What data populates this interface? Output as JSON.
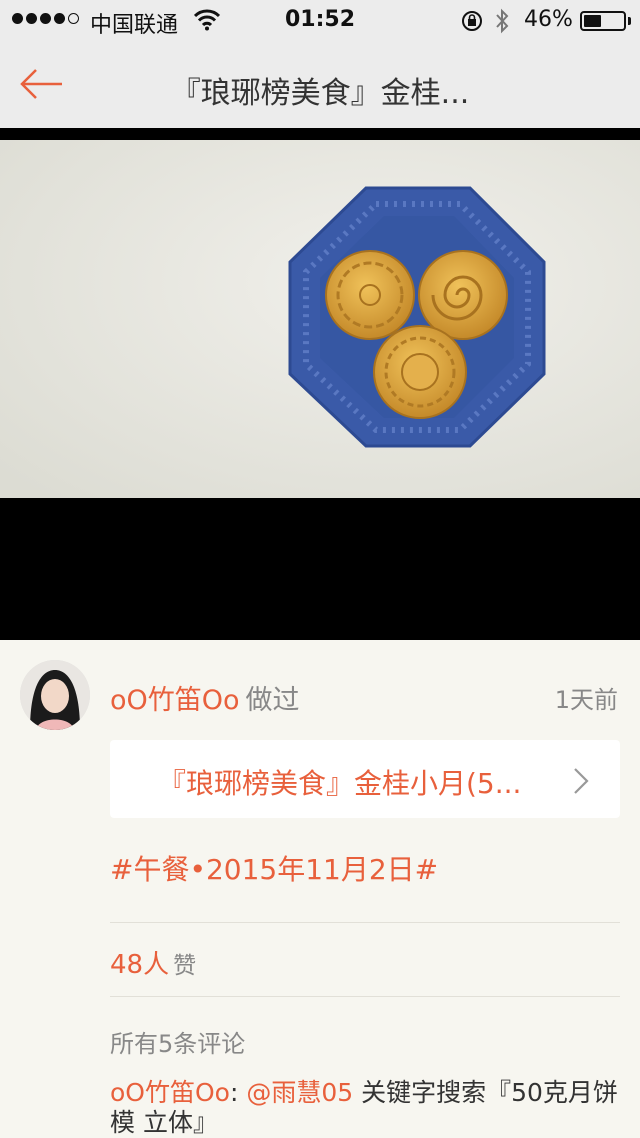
{
  "status_bar": {
    "carrier": "中国联通",
    "time": "01:52",
    "battery_percent": "46%",
    "battery_level": 0.46
  },
  "nav": {
    "title": "『琅琊榜美食』金桂..."
  },
  "post": {
    "username": "oO竹笛Oo",
    "action": "做过",
    "time_ago": "1天前",
    "recipe_title": "『琅琊榜美食』金桂小月(5...",
    "tag": "#午餐•2015年11月2日#",
    "likes_count": "48人",
    "likes_label": "赞",
    "comments_header": "所有5条评论"
  },
  "comment": {
    "user": "oO竹笛Oo",
    "separator": ": ",
    "mention": "@雨慧05",
    "text": " 关键字搜索『50克月饼模 立体』"
  },
  "colors": {
    "accent": "#e8603c",
    "plate": "#3a5aa8",
    "mooncake": "#d7a23d"
  }
}
